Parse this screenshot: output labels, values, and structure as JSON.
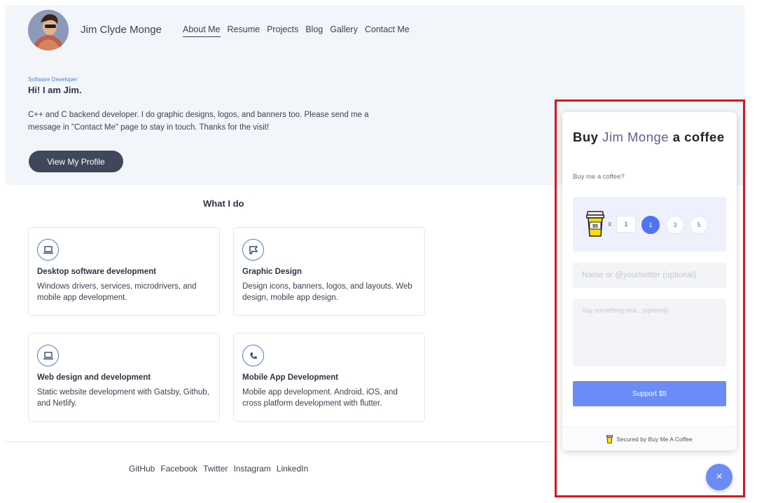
{
  "header": {
    "site_name": "Jim Clyde Monge",
    "nav": [
      "About Me",
      "Resume",
      "Projects",
      "Blog",
      "Gallery",
      "Contact Me"
    ]
  },
  "hero": {
    "role": "Software Developer",
    "greeting": "Hi! I am Jim.",
    "intro_line1": "C++ and C backend developer. I do graphic designs, logos, and banners too. Please send me a",
    "intro_line2": "message in \"Contact Me\" page to stay in touch. Thanks for the visit!",
    "button": "View My Profile"
  },
  "services": {
    "title": "What I do",
    "cards": [
      {
        "icon": "laptop-icon",
        "title": "Desktop software development",
        "desc": "Windows drivers, services, microdrivers, and mobile app development."
      },
      {
        "icon": "flag-icon",
        "title": "Graphic Design",
        "desc": "Design icons, banners, logos, and layouts. Web design, mobile app design."
      },
      {
        "icon": "laptop-icon",
        "title": "Web design and development",
        "desc": "Static website development with Gatsby, Github, and Netlify."
      },
      {
        "icon": "phone-icon",
        "title": "Mobile App Development",
        "desc": "Mobile app development. Android, iOS, and cross platform development with flutter."
      }
    ]
  },
  "footer": {
    "links": [
      "GitHub",
      "Facebook",
      "Twitter",
      "Instagram",
      "LinkedIn"
    ]
  },
  "widget": {
    "title_prefix": "Buy",
    "title_name": "Jim Monge",
    "title_suffix": "a coffee",
    "subtitle": "Buy me a coffee?",
    "price_tag": "$5",
    "times": "x",
    "qty_value": "1",
    "qty_options": [
      "1",
      "3",
      "5"
    ],
    "selected_qty": "1",
    "name_placeholder": "Name or @yourtwitter (optional)",
    "message_placeholder": "Say something nice.. (optional)",
    "support_button": "Support  $5",
    "secured": "Secured by Buy Me A Coffee",
    "close": "×"
  },
  "colors": {
    "accent": "#6b8cf6",
    "selected": "#5173f2",
    "hero_bg": "#f2f6fa",
    "highlight_frame": "#d9141b"
  }
}
